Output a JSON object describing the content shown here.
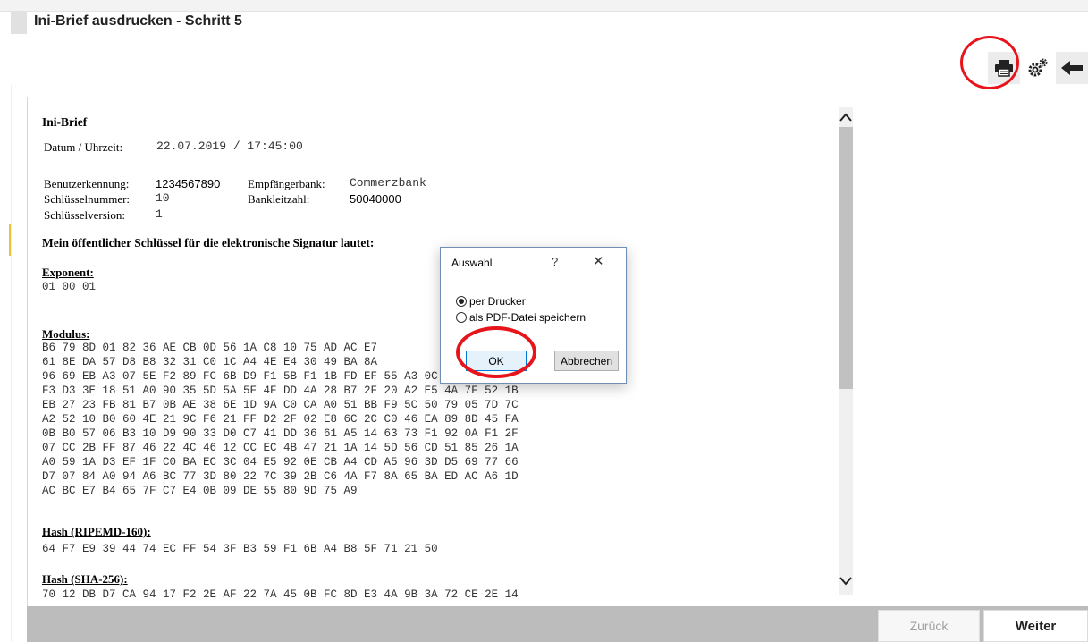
{
  "page": {
    "title": "Ini-Brief ausdrucken - Schritt 5"
  },
  "doc": {
    "heading": "Ini-Brief",
    "datum_label": "Datum / Uhrzeit:",
    "datum_value": "22.07.2019 / 17:45:00",
    "benutzer_label": "Benutzerkennung:",
    "benutzer_value": "1234567890",
    "empfaenger_label": "Empfängerbank:",
    "empfaenger_value": "Commerzbank",
    "schluesselnummer_label": "Schlüsselnummer:",
    "schluesselnummer_value": "10",
    "blz_label": "Bankleitzahl:",
    "blz_value": "50040000",
    "schluesselversion_label": "Schlüsselversion:",
    "schluesselversion_value": "1",
    "intro": "Mein öffentlicher Schlüssel für die elektronische Signatur lautet:",
    "exponent_label": "Exponent:",
    "exponent_value": "01 00 01",
    "modulus_label": "Modulus:",
    "modulus_lines": [
      "B6 79 8D 01 82 36 AE CB 0D 56 1A C8 10 75 AD AC E7",
      "61 8E DA 57 D8 B8 32 31 C0 1C A4 4E E4 30 49 BA 8A",
      "96 69 EB A3 07 5E F2 89 FC 6B D9 F1 5B F1 1B FD EF 55 A3 0C 50 1B 78 BE",
      "F3 D3 3E 18 51 A0 90 35 5D 5A 5F 4F DD 4A 28 B7 2F 20 A2 E5 4A 7F 52 1B",
      "EB 27 23 FB 81 B7 0B AE 38 6E 1D 9A C0 CA A0 51 BB F9 5C 50 79 05 7D 7C",
      "A2 52 10 B0 60 4E 21 9C F6 21 FF D2 2F 02 E8 6C 2C C0 46 EA 89 8D 45 FA",
      "0B B0 57 06 B3 10 D9 90 33 D0 C7 41 DD 36 61 A5 14 63 73 F1 92 0A F1 2F",
      "07 CC 2B FF 87 46 22 4C 46 12 CC EC 4B 47 21 1A 14 5D 56 CD 51 85 26 1A",
      "A0 59 1A D3 EF 1F C0 BA EC 3C 04 E5 92 0E CB A4 CD A5 96 3D D5 69 77 66",
      "D7 07 84 A0 94 A6 BC 77 3D 80 22 7C 39 2B C6 4A F7 8A 65 BA ED AC A6 1D",
      "AC BC E7 B4 65 7F C7 E4 0B 09 DE 55 80 9D 75 A9"
    ],
    "ripemd_label": "Hash (RIPEMD-160):",
    "ripemd_value": "64 F7 E9 39 44 74 EC FF 54 3F B3 59 F1 6B A4 B8 5F 71 21 50",
    "sha_label": "Hash (SHA-256):",
    "sha_value": "70 12 DB D7 CA 94 17 F2 2E AF 22 7A 45 0B FC 8D E3 4A 9B 3A 72 CE 2E 14"
  },
  "dialog": {
    "title": "Auswahl",
    "help": "?",
    "close": "✕",
    "option_printer": "per Drucker",
    "option_pdf": "als PDF-Datei speichern",
    "ok": "OK",
    "cancel": "Abbrechen"
  },
  "footer": {
    "back": "Zurück",
    "next": "Weiter"
  },
  "colors": {
    "highlight": "#e8141c",
    "footer_bg": "#bcbcbc"
  },
  "icons": [
    "print-icon",
    "settings-icon",
    "back-arrow-icon",
    "scroll-up-icon",
    "scroll-down-icon"
  ]
}
